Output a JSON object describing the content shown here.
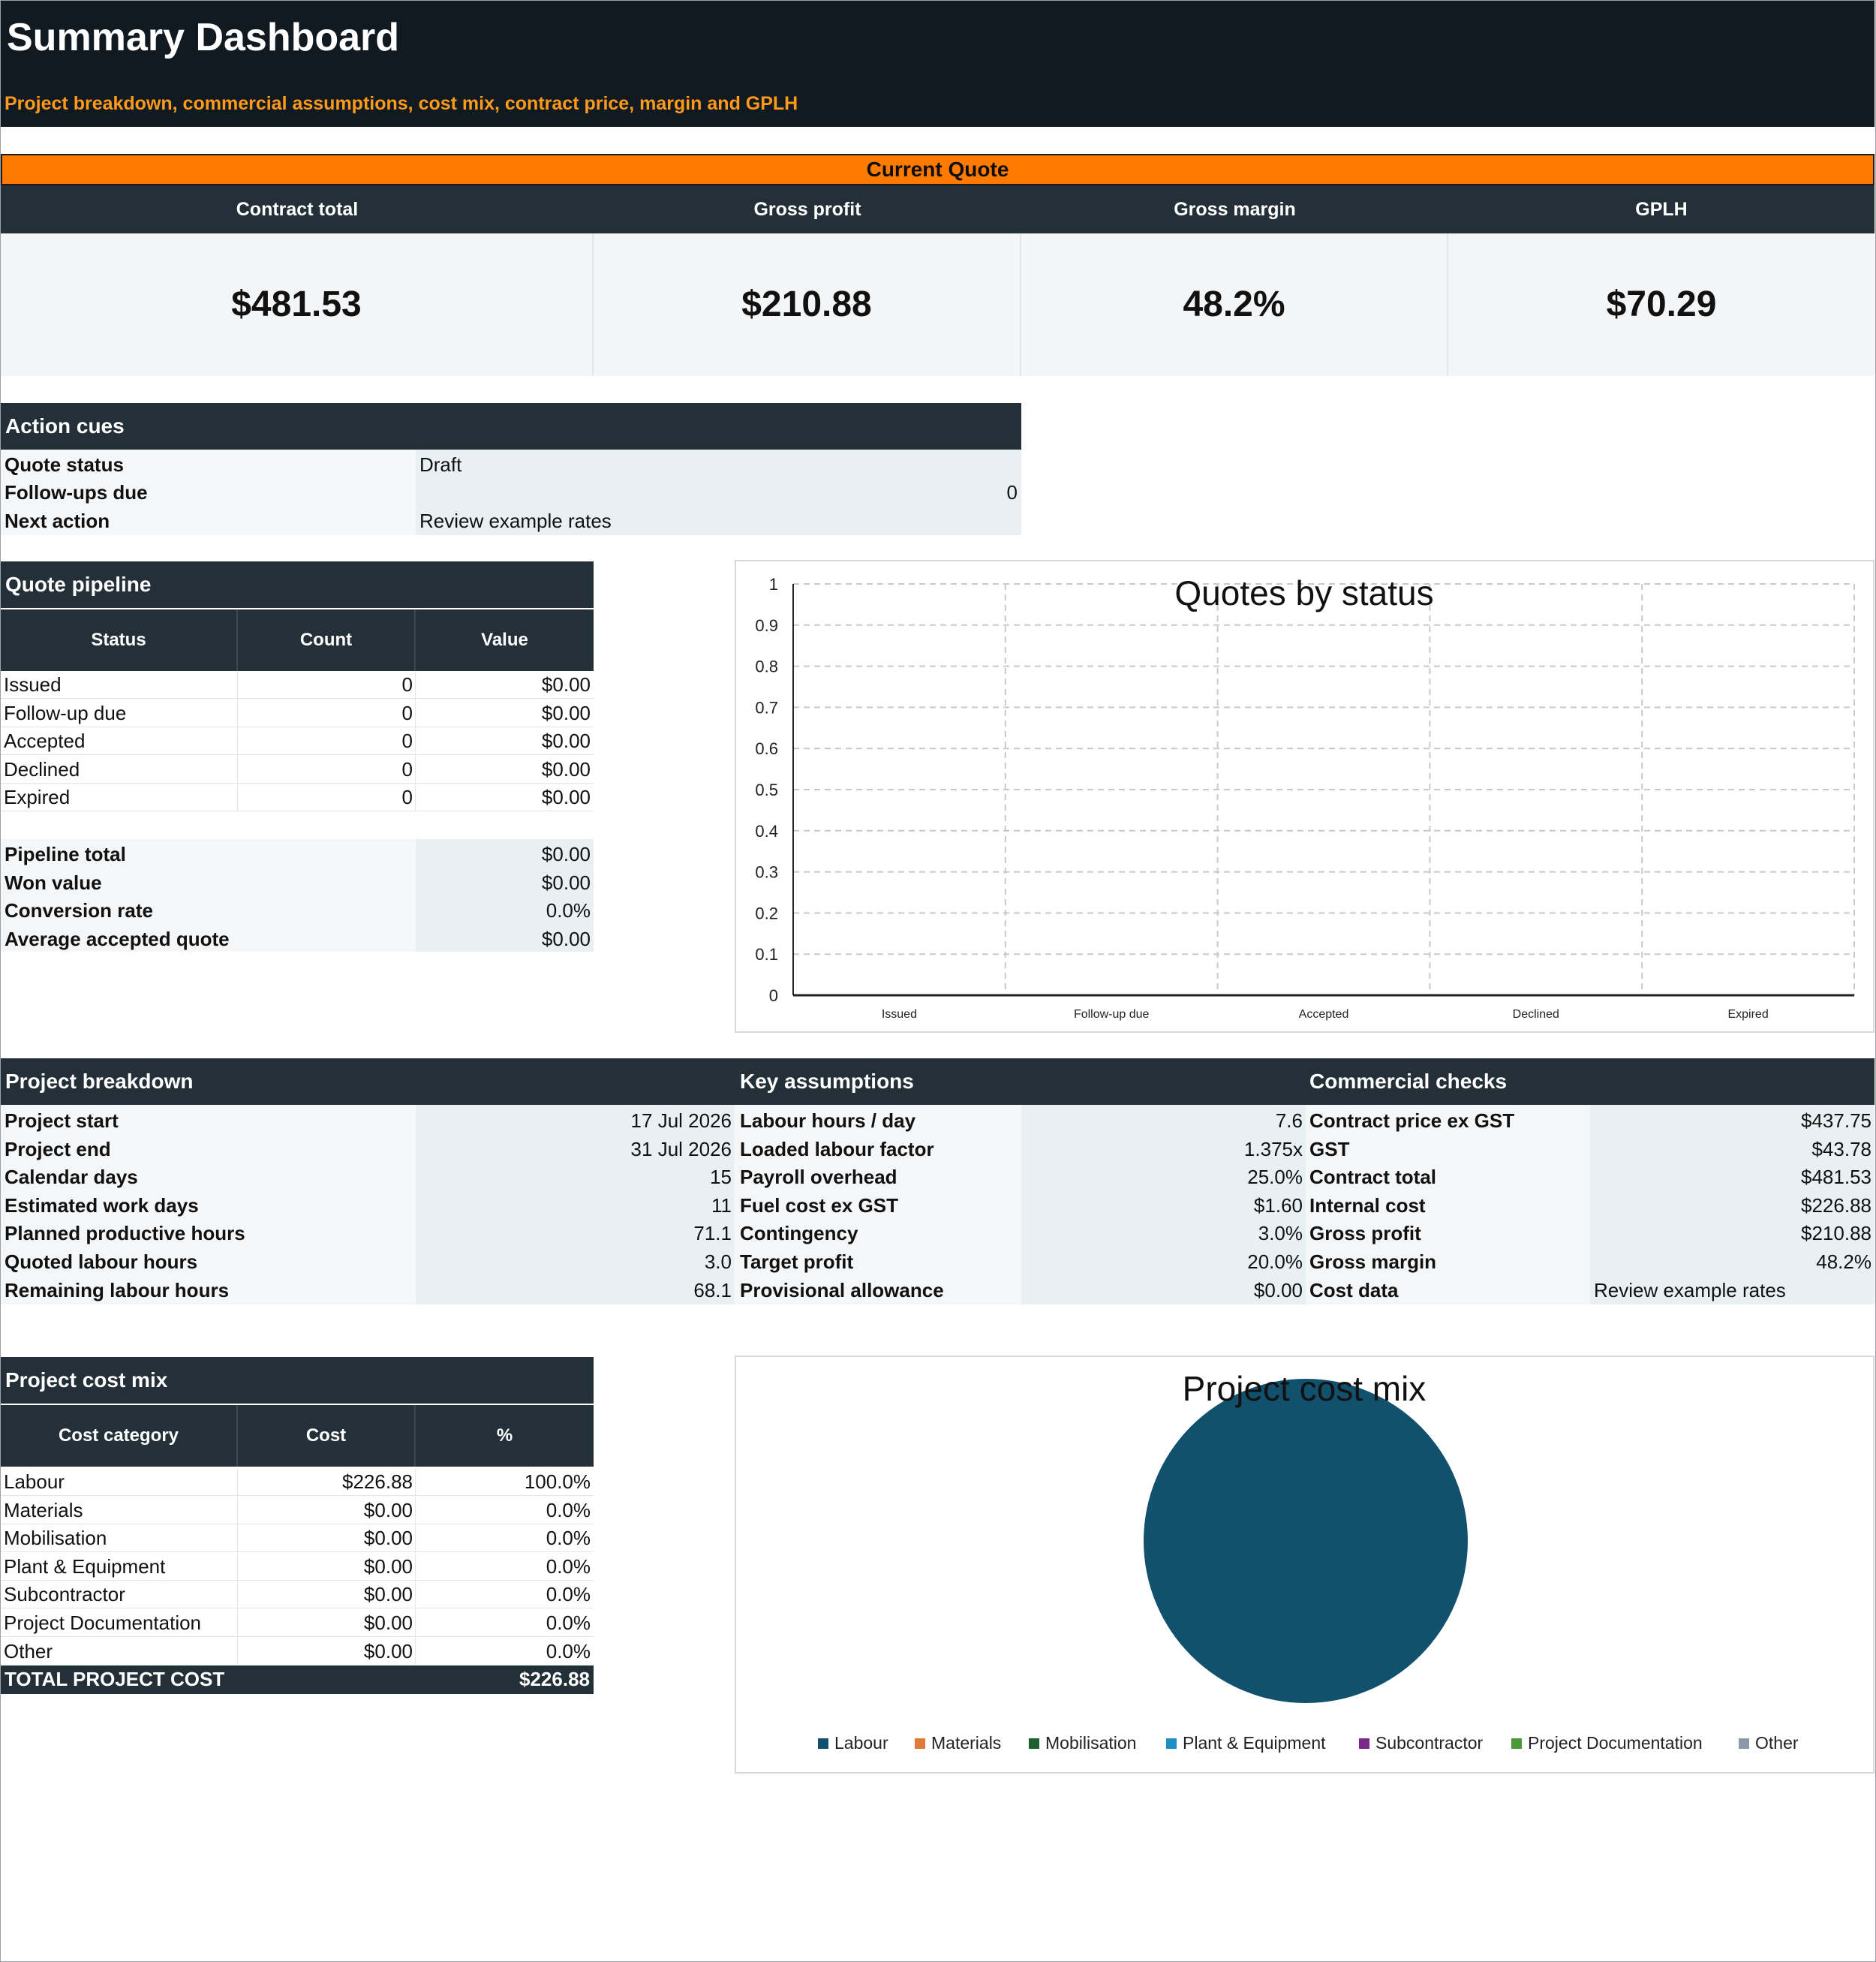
{
  "header": {
    "title": "Summary Dashboard",
    "subtitle": "Project breakdown, commercial assumptions, cost mix, contract price, margin and GPLH"
  },
  "current_quote": {
    "band_label": "Current Quote",
    "kpis": [
      {
        "label": "Contract total",
        "value": "$481.53"
      },
      {
        "label": "Gross profit",
        "value": "$210.88"
      },
      {
        "label": "Gross margin",
        "value": "48.2%"
      },
      {
        "label": "GPLH",
        "value": "$70.29"
      }
    ]
  },
  "action_cues": {
    "title": "Action cues",
    "rows": [
      {
        "label": "Quote status",
        "value": "Draft"
      },
      {
        "label": "Follow-ups due",
        "value": "0"
      },
      {
        "label": "Next action",
        "value": "Review example rates"
      }
    ]
  },
  "quote_pipeline": {
    "title": "Quote pipeline",
    "columns": [
      "Status",
      "Count",
      "Value"
    ],
    "rows": [
      {
        "status": "Issued",
        "count": "0",
        "value": "$0.00"
      },
      {
        "status": "Follow-up due",
        "count": "0",
        "value": "$0.00"
      },
      {
        "status": "Accepted",
        "count": "0",
        "value": "$0.00"
      },
      {
        "status": "Declined",
        "count": "0",
        "value": "$0.00"
      },
      {
        "status": "Expired",
        "count": "0",
        "value": "$0.00"
      }
    ],
    "summary": [
      {
        "label": "Pipeline total",
        "value": "$0.00"
      },
      {
        "label": "Won value",
        "value": "$0.00"
      },
      {
        "label": "Conversion rate",
        "value": "0.0%"
      },
      {
        "label": "Average accepted quote",
        "value": "$0.00"
      }
    ]
  },
  "project_breakdown": {
    "titles": [
      "Project breakdown",
      "Key assumptions",
      "Commercial checks"
    ],
    "breakdown": [
      {
        "label": "Project start",
        "value": "17 Jul 2026"
      },
      {
        "label": "Project end",
        "value": "31 Jul 2026"
      },
      {
        "label": "Calendar days",
        "value": "15"
      },
      {
        "label": "Estimated work days",
        "value": "11"
      },
      {
        "label": "Planned productive hours",
        "value": "71.1"
      },
      {
        "label": "Quoted labour hours",
        "value": "3.0"
      },
      {
        "label": "Remaining labour hours",
        "value": "68.1"
      }
    ],
    "assumptions": [
      {
        "label": "Labour hours / day",
        "value": "7.6"
      },
      {
        "label": "Loaded labour factor",
        "value": "1.375x"
      },
      {
        "label": "Payroll overhead",
        "value": "25.0%"
      },
      {
        "label": "Fuel cost ex GST",
        "value": "$1.60"
      },
      {
        "label": "Contingency",
        "value": "3.0%"
      },
      {
        "label": "Target profit",
        "value": "20.0%"
      },
      {
        "label": "Provisional allowance",
        "value": "$0.00"
      }
    ],
    "commercial": [
      {
        "label": "Contract price ex GST",
        "value": "$437.75"
      },
      {
        "label": "GST",
        "value": "$43.78"
      },
      {
        "label": "Contract total",
        "value": "$481.53"
      },
      {
        "label": "Internal cost",
        "value": "$226.88"
      },
      {
        "label": "Gross profit",
        "value": "$210.88"
      },
      {
        "label": "Gross margin",
        "value": "48.2%"
      },
      {
        "label": "Cost data",
        "value": "Review example rates"
      }
    ]
  },
  "project_cost_mix": {
    "title": "Project cost mix",
    "columns": [
      "Cost category",
      "Cost",
      "%"
    ],
    "rows": [
      {
        "category": "Labour",
        "cost": "$226.88",
        "pct": "100.0%"
      },
      {
        "category": "Materials",
        "cost": "$0.00",
        "pct": "0.0%"
      },
      {
        "category": "Mobilisation",
        "cost": "$0.00",
        "pct": "0.0%"
      },
      {
        "category": "Plant & Equipment",
        "cost": "$0.00",
        "pct": "0.0%"
      },
      {
        "category": "Subcontractor",
        "cost": "$0.00",
        "pct": "0.0%"
      },
      {
        "category": "Project Documentation",
        "cost": "$0.00",
        "pct": "0.0%"
      },
      {
        "category": "Other",
        "cost": "$0.00",
        "pct": "0.0%"
      }
    ],
    "total_label": "TOTAL PROJECT COST",
    "total_value": "$226.88"
  },
  "chart_data": [
    {
      "type": "bar",
      "title": "Quotes by status",
      "categories": [
        "Issued",
        "Follow-up due",
        "Accepted",
        "Declined",
        "Expired"
      ],
      "values": [
        0,
        0,
        0,
        0,
        0
      ],
      "ylim": [
        0,
        1
      ],
      "yticks": [
        "0",
        "0.1",
        "0.2",
        "0.3",
        "0.4",
        "0.5",
        "0.6",
        "0.7",
        "0.8",
        "0.9",
        "1"
      ],
      "grid": true,
      "legend": "none"
    },
    {
      "type": "pie",
      "title": "Project cost mix",
      "categories": [
        "Labour",
        "Materials",
        "Mobilisation",
        "Plant & Equipment",
        "Subcontractor",
        "Project Documentation",
        "Other"
      ],
      "values": [
        226.88,
        0,
        0,
        0,
        0,
        0,
        0
      ],
      "colors": [
        "#12516e",
        "#e07a3a",
        "#1f5e2e",
        "#1f8fc4",
        "#7a2a8a",
        "#4a9a3a",
        "#8a9aaa"
      ],
      "legend": "bottom"
    }
  ]
}
